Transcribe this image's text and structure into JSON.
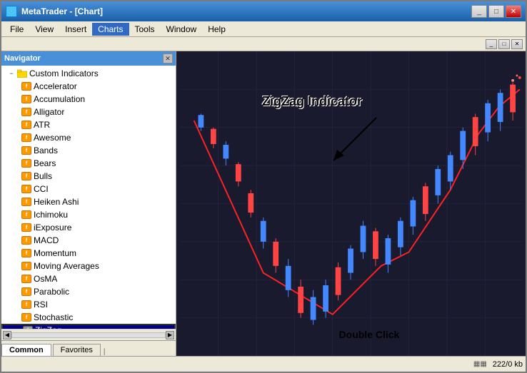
{
  "window": {
    "title": "MetaTrader - [Chart]",
    "title_icon": "MT",
    "buttons": {
      "minimize": "_",
      "maximize": "□",
      "close": "✕"
    }
  },
  "menu": {
    "items": [
      "File",
      "View",
      "Insert",
      "Charts",
      "Tools",
      "Window",
      "Help"
    ],
    "active": "Charts"
  },
  "navigator": {
    "title": "Navigator",
    "close_btn": "✕",
    "tree": {
      "root_expand": "−",
      "root_label": "Custom Indicators",
      "items": [
        "Accelerator",
        "Accumulation",
        "Alligator",
        "ATR",
        "Awesome",
        "Bands",
        "Bears",
        "Bulls",
        "CCI",
        "Heiken Ashi",
        "Ichimoku",
        "iExposure",
        "MACD",
        "Momentum",
        "Moving Averages",
        "OsMA",
        "Parabolic",
        "RSI",
        "Stochastic",
        "ZigZag"
      ]
    },
    "tabs": [
      "Common",
      "Favorites"
    ]
  },
  "chart": {
    "annotation_label": "ZigZag Indicator",
    "double_click_label": "Double Click"
  },
  "status_bar": {
    "right_text": "222/0 kb"
  },
  "icons": {
    "grid_icon": "▦",
    "indicator_symbol": "f"
  }
}
